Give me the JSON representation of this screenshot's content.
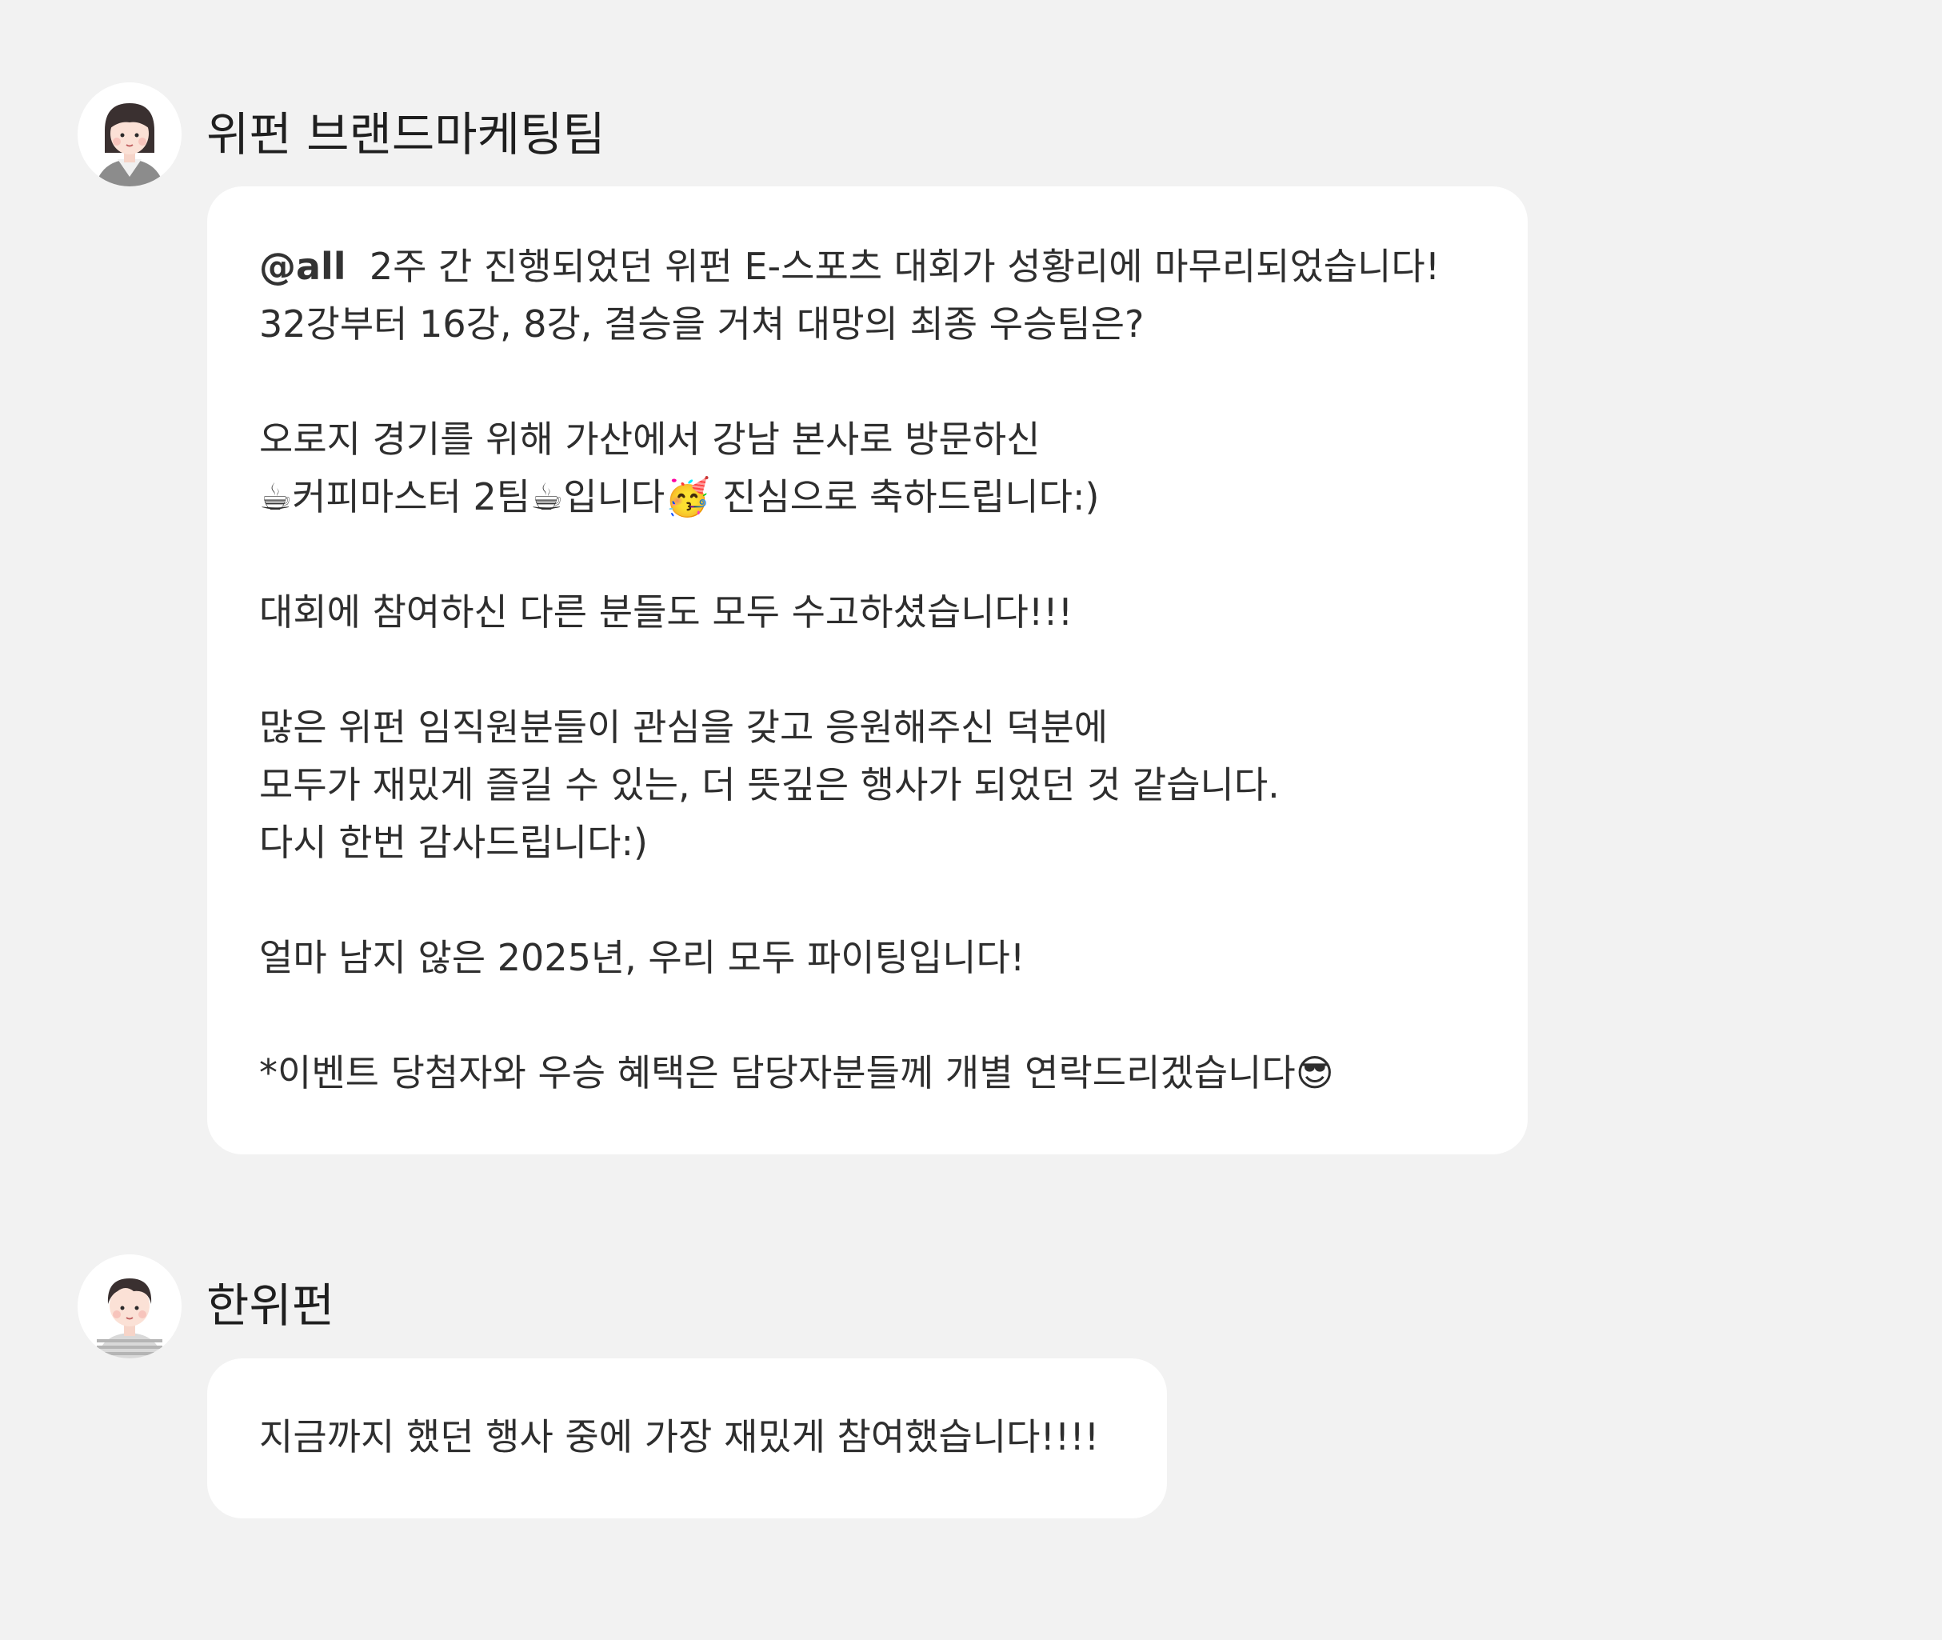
{
  "messages": [
    {
      "sender": "위펀 브랜드마케팅팀",
      "avatar_icon": "woman-avatar-icon",
      "mention": "@all",
      "lines": [
        "2주 간 진행되었던 위펀 E-스포츠 대회가 성황리에 마무리되었습니다!",
        "32강부터 16강, 8강, 결승을 거쳐 대망의 최종 우승팀은?",
        "",
        "오로지 경기를 위해 가산에서 강남 본사로 방문하신",
        "☕커피마스터 2팀☕입니다🥳 진심으로 축하드립니다:)",
        "",
        "대회에 참여하신 다른 분들도 모두 수고하셨습니다!!!",
        "",
        "많은 위펀 임직원분들이 관심을 갖고 응원해주신 덕분에",
        "모두가 재밌게 즐길 수 있는, 더 뜻깊은 행사가 되었던 것 같습니다.",
        "다시 한번 감사드립니다:)",
        "",
        "얼마 남지 않은 2025년, 우리 모두 파이팅입니다!",
        "",
        "*이벤트 당첨자와 우승 혜택은 담당자분들께 개별 연락드리겠습니다😎"
      ]
    },
    {
      "sender": "한위펀",
      "avatar_icon": "man-avatar-icon",
      "lines": [
        "지금까지 했던 행사 중에 가장 재밌게 참여했습니다!!!!"
      ]
    }
  ],
  "colors": {
    "background": "#f2f2f2",
    "bubble": "#ffffff",
    "text": "#2e2e2e"
  }
}
